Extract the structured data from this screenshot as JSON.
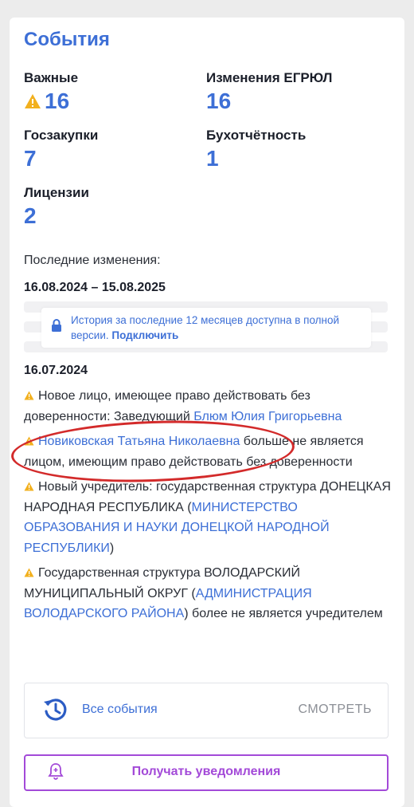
{
  "title": "События",
  "stats": {
    "important": {
      "label": "Важные",
      "value": "16"
    },
    "egrul": {
      "label": "Изменения ЕГРЮЛ",
      "value": "16"
    },
    "procurement": {
      "label": "Госзакупки",
      "value": "7"
    },
    "accounting": {
      "label": "Бухотчётность",
      "value": "1"
    },
    "licenses": {
      "label": "Лицензии",
      "value": "2"
    }
  },
  "recent": {
    "label": "Последние изменения:",
    "range": "16.08.2024 – 15.08.2025"
  },
  "history_notice": {
    "text": "История за последние 12 месяцев доступна в полной версии.",
    "link": "Подключить"
  },
  "date": "16.07.2024",
  "events": [
    {
      "text_before": "Новое лицо, имеющее право действовать без доверенности: Заведующий ",
      "link": "Блюм Юлия Григорьевна",
      "text_after": ""
    },
    {
      "text_before": "",
      "link": "Новиковская Татьяна Николаевна",
      "text_after": " больше не является лицом, имеющим право действовать без доверенности"
    },
    {
      "text_before": "Новый учредитель: государственная структура ДОНЕЦКАЯ НАРОДНАЯ РЕСПУБЛИКА (",
      "link": "МИНИСТЕРСТВО ОБРАЗОВАНИЯ И НАУКИ ДОНЕЦКОЙ НАРОДНОЙ РЕСПУБЛИКИ",
      "text_after": ")"
    },
    {
      "text_before": "Государственная структура ВОЛОДАРСКИЙ МУНИЦИПАЛЬНЫЙ ОКРУГ (",
      "link": "АДМИНИСТРАЦИЯ ВОЛОДАРСКОГО РАЙОНА",
      "text_after": ") более не является учредителем"
    }
  ],
  "all_events": {
    "label": "Все события",
    "action": "СМОТРЕТЬ"
  },
  "notify_button": "Получать уведомления",
  "colors": {
    "accent": "#3d6fd6",
    "warning": "#f2b01e",
    "purple": "#a34ad8",
    "annotation": "#d32a2a"
  },
  "icons": [
    "warning-icon",
    "lock-icon",
    "history-icon",
    "bell-icon"
  ]
}
